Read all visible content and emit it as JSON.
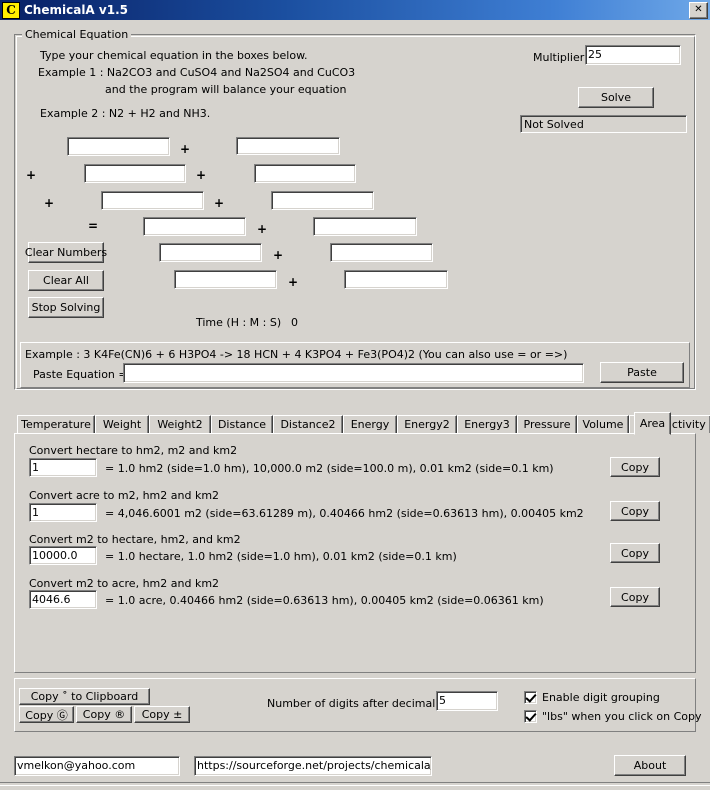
{
  "window": {
    "title": "ChemicalA v1.5",
    "icon": "app-c-icon",
    "close_label": "✕",
    "titlebar_color": "#0a246a"
  },
  "equation_group": {
    "legend": "Chemical Equation",
    "instruction": "Type your chemical equation in the boxes below.",
    "example1": "Example 1 : Na2CO3 and CuSO4 and Na2SO4 and CuCO3",
    "example1_cont": "and the program will balance your equation",
    "example2": "Example 2 : N2 + H2 and NH3.",
    "multiplier_label": "Multiplier",
    "multiplier_value": "25",
    "solve_label": "Solve",
    "status_text": "Not Solved",
    "clear_numbers_label": "Clear Numbers",
    "clear_all_label": "Clear All",
    "stop_solving_label": "Stop Solving",
    "time_label": "Time (H : M : S)",
    "time_value": "0",
    "operators": {
      "plus": "+",
      "equals": "="
    },
    "input_values": [
      "",
      "",
      "",
      "",
      "",
      "",
      "",
      "",
      "",
      "",
      "",
      "",
      "",
      ""
    ]
  },
  "paste_panel": {
    "example": "Example : 3 K4Fe(CN)6 + 6 H3PO4 -> 18 HCN + 4 K3PO4 + Fe3(PO4)2 (You can also use = or =>)",
    "paste_equation_label": "Paste Equation =",
    "paste_equation_value": "",
    "paste_button_label": "Paste"
  },
  "tabs": {
    "active": "Area",
    "items": [
      {
        "label": "Temperature"
      },
      {
        "label": "Weight"
      },
      {
        "label": "Weight2"
      },
      {
        "label": "Distance"
      },
      {
        "label": "Distance2"
      },
      {
        "label": "Energy"
      },
      {
        "label": "Energy2"
      },
      {
        "label": "Energy3"
      },
      {
        "label": "Pressure"
      },
      {
        "label": "Volume"
      },
      {
        "label": "Radioactivity"
      },
      {
        "label": "Area"
      }
    ]
  },
  "area_tab": {
    "conversions": [
      {
        "title": "Convert hectare to hm2, m2 and km2",
        "value": "1",
        "result": "= 1.0 hm2 (side=1.0 hm), 10,000.0 m2 (side=100.0 m), 0.01 km2 (side=0.1 km)",
        "copy_label": "Copy"
      },
      {
        "title": "Convert acre to m2, hm2 and km2",
        "value": "1",
        "result": "= 4,046.6001 m2 (side=63.61289 m), 0.40466 hm2 (side=0.63613 hm), 0.00405 km2",
        "copy_label": "Copy"
      },
      {
        "title": "Convert m2 to hectare, hm2, and km2",
        "value": "10000.0",
        "result": "= 1.0 hectare, 1.0 hm2 (side=1.0 hm), 0.01 km2 (side=0.1 km)",
        "copy_label": "Copy"
      },
      {
        "title": "Convert m2 to acre, hm2 and km2",
        "value": "4046.6",
        "result": "= 1.0 acre, 0.40466 hm2 (side=0.63613 hm), 0.00405 km2 (side=0.06361 km)",
        "copy_label": "Copy"
      }
    ]
  },
  "bottom": {
    "copy_clipboard_label": "Copy ˚ to Clipboard",
    "copy_c_label": "Copy Ⓖ",
    "copy_r_label": "Copy ®",
    "copy_pm_label": "Copy ±",
    "digits_label": "Number of digits after decimal point",
    "digits_value": "5",
    "checkbox_grouping_label": "Enable digit grouping",
    "checkbox_grouping_checked": true,
    "checkbox_lbs_label": "\"lbs\" when you click on Copy",
    "checkbox_lbs_checked": true
  },
  "footer": {
    "email": "vmelkon@yahoo.com",
    "url": "https://sourceforge.net/projects/chemicala/",
    "about_label": "About"
  }
}
